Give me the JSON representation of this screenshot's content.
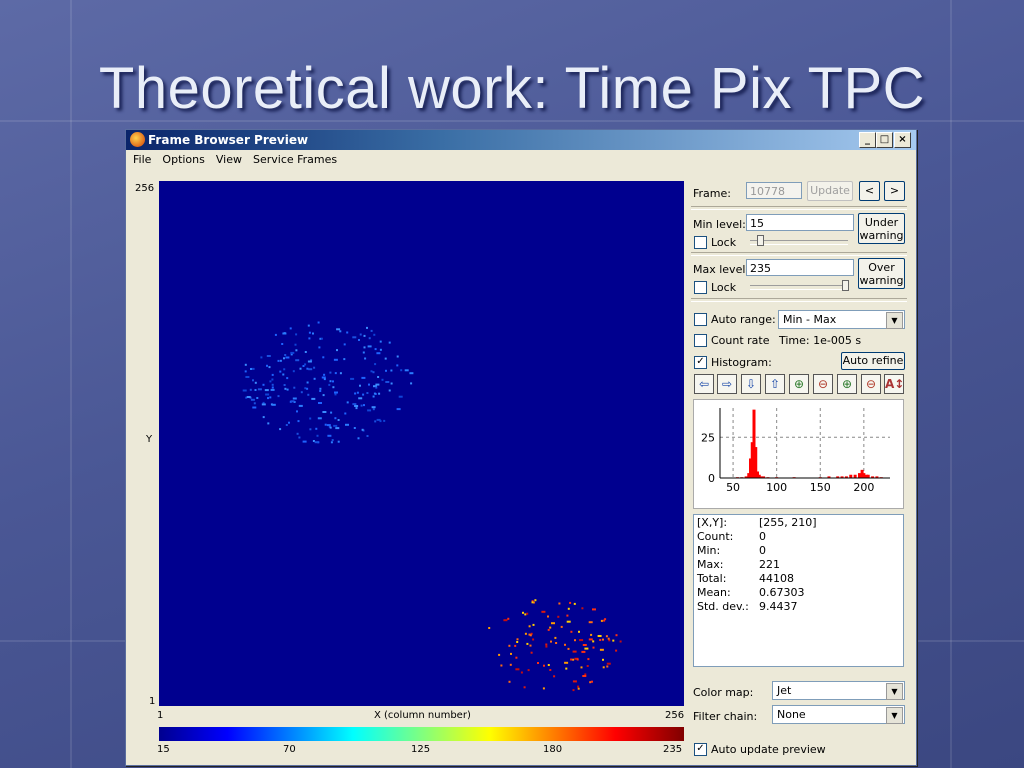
{
  "slide": {
    "title": "Theoretical work: Time Pix TPC"
  },
  "window": {
    "title": "Frame Browser Preview",
    "buttons": {
      "minimize": "_",
      "maximize": "□",
      "close": "×"
    }
  },
  "menu": [
    "File",
    "Options",
    "View",
    "Service Frames"
  ],
  "plot": {
    "y_top_label": "256",
    "y_bottom_label": "1",
    "y_axis_label": "Y",
    "x_left_label": "1",
    "x_axis_label": "X (column number)",
    "x_right_label": "256",
    "colorbar_ticks": [
      "15",
      "70",
      "125",
      "180",
      "235"
    ]
  },
  "panel": {
    "frame_label": "Frame:",
    "frame_value": "10778",
    "update_button": "Update",
    "prev_button": "<",
    "next_button": ">",
    "min_level_label": "Min level:",
    "min_level_value": "15",
    "under_warning_line1": "Under",
    "under_warning_line2": "warning",
    "lock_label": "Lock",
    "max_level_label": "Max level:",
    "max_level_value": "235",
    "over_warning_line1": "Over",
    "over_warning_line2": "warning",
    "auto_range_label": "Auto range:",
    "auto_range_value": "Min - Max",
    "count_rate_label": "Count rate",
    "time_text": "Time: 1e-005 s",
    "histogram_label": "Histogram:",
    "histogram_checked": true,
    "auto_refine_button": "Auto refine",
    "color_map_label": "Color map:",
    "color_map_value": "Jet",
    "filter_chain_label": "Filter chain:",
    "filter_chain_value": "None",
    "auto_update_label": "Auto update preview",
    "auto_update_checked": true
  },
  "toolbar_icons": [
    "arrow-left-icon",
    "arrow-right-icon",
    "arrow-down-icon",
    "arrow-up-icon",
    "zoom-in-x-icon",
    "zoom-out-x-icon",
    "zoom-in-y-icon",
    "zoom-out-y-icon",
    "auto-scale-icon"
  ],
  "stats": [
    {
      "key": "[X,Y]:",
      "value": "[255, 210]"
    },
    {
      "key": "Count:",
      "value": "0"
    },
    {
      "key": "Min:",
      "value": "0"
    },
    {
      "key": "Max:",
      "value": "221"
    },
    {
      "key": "Total:",
      "value": "44108"
    },
    {
      "key": "Mean:",
      "value": "0.67303"
    },
    {
      "key": "Std. dev.:",
      "value": "9.4437"
    }
  ],
  "chart_data": {
    "type": "bar",
    "title": "",
    "xlabel": "",
    "ylabel": "",
    "x_ticks": [
      "50",
      "100",
      "150",
      "200"
    ],
    "y_ticks": [
      "0",
      "25"
    ],
    "xlim": [
      35,
      230
    ],
    "ylim": [
      0,
      43
    ],
    "grid": true,
    "color": "#ff0000",
    "x": [
      55,
      60,
      65,
      68,
      70,
      72,
      74,
      76,
      78,
      80,
      82,
      85,
      90,
      100,
      120,
      150,
      160,
      170,
      175,
      180,
      185,
      190,
      195,
      198,
      200,
      203,
      205,
      210,
      215,
      220
    ],
    "values": [
      0.5,
      0.5,
      1,
      3,
      12,
      22,
      42,
      19,
      4,
      2,
      1,
      1,
      0.5,
      0.5,
      0.5,
      0.5,
      1,
      1,
      1,
      1,
      2,
      2,
      3,
      5,
      3,
      2,
      2,
      1,
      1,
      0.5
    ]
  },
  "colors": {
    "plot_background": "#00008f",
    "cluster_low": "#1e64ff",
    "cluster_high": "#ff3010"
  }
}
